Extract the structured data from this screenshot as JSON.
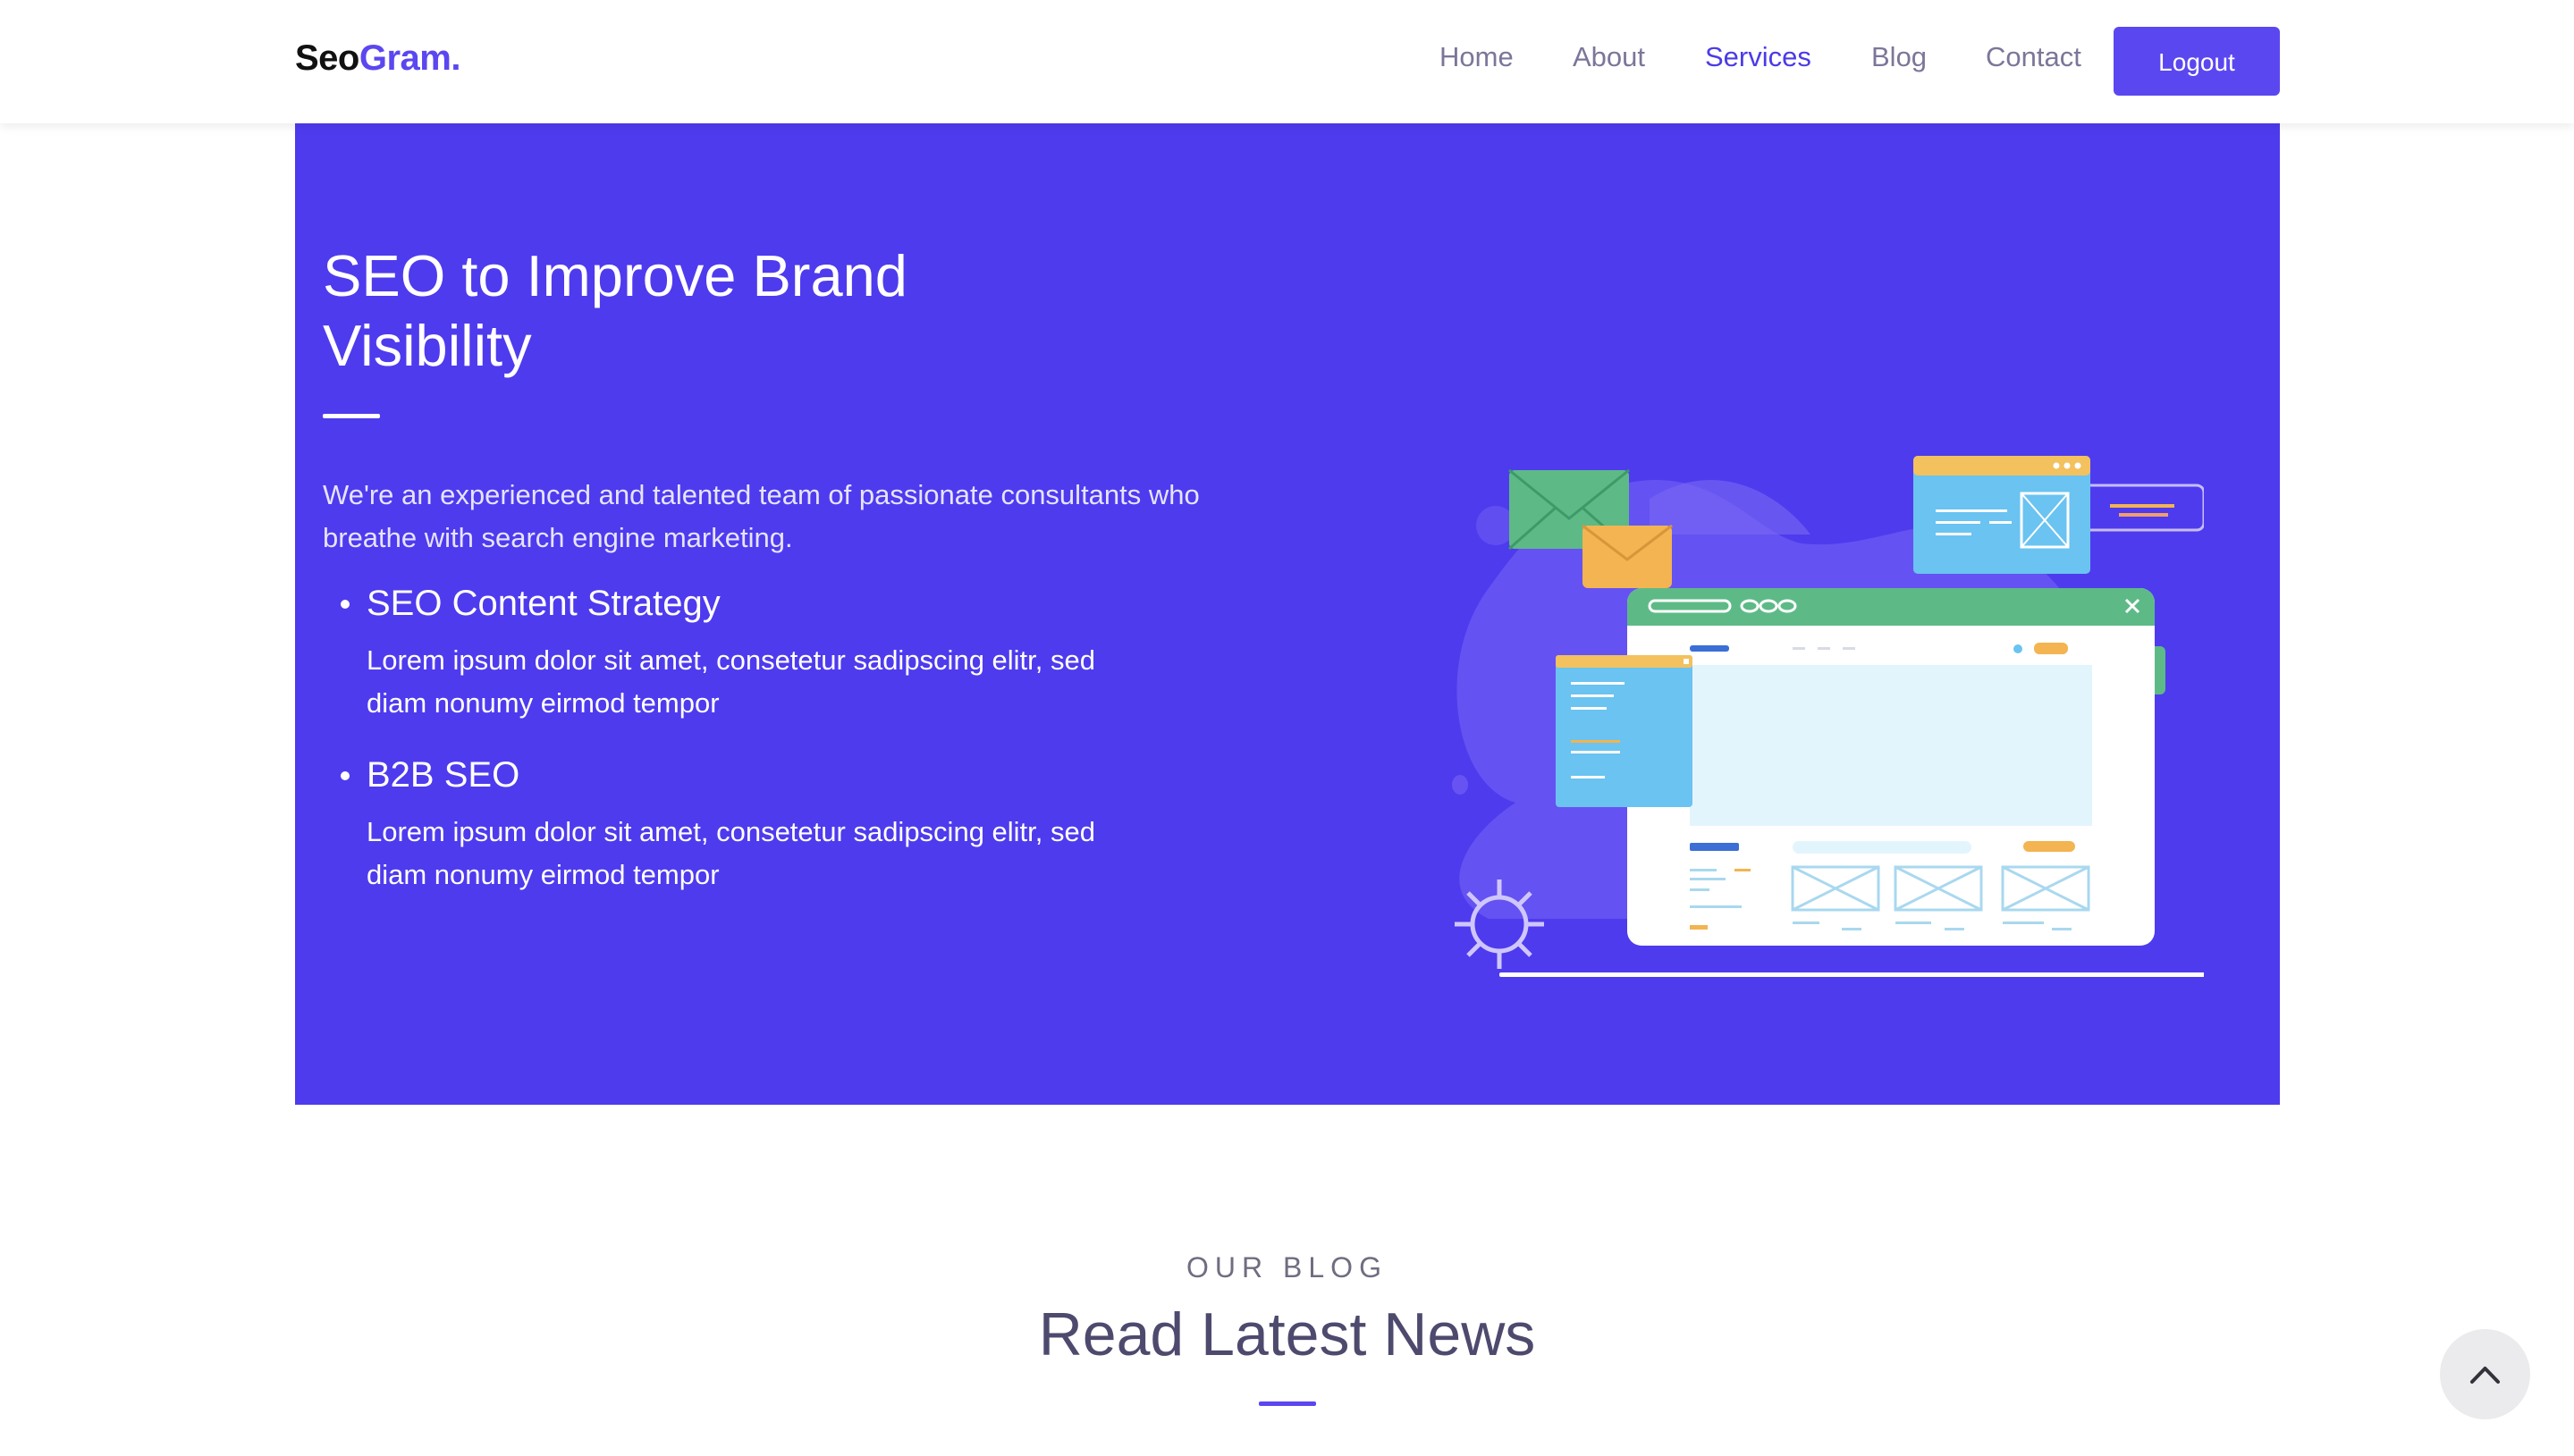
{
  "navbar": {
    "logo": {
      "part1": "Seo",
      "part2": "Gram."
    },
    "links": [
      {
        "label": "Home",
        "active": false
      },
      {
        "label": "About",
        "active": false
      },
      {
        "label": "Services",
        "active": true
      },
      {
        "label": "Blog",
        "active": false
      },
      {
        "label": "Contact",
        "active": false
      }
    ],
    "logout_label": "Logout"
  },
  "hero": {
    "title": "SEO to Improve Brand Visibility",
    "description": "We're an experienced and talented team of passionate consultants who breathe with search engine marketing.",
    "features": [
      {
        "title": "SEO Content Strategy",
        "description": "Lorem ipsum dolor sit amet, consetetur sadipscing elitr, sed diam nonumy eirmod tempor"
      },
      {
        "title": "B2B SEO",
        "description": "Lorem ipsum dolor sit amet, consetetur sadipscing elitr, sed diam nonumy eirmod tempor"
      }
    ],
    "illustration_icon": "seo-website-illustration"
  },
  "blog": {
    "eyebrow": "OUR BLOG",
    "title": "Read Latest News"
  },
  "scroll_top_icon": "chevron-up-icon",
  "colors": {
    "brand": "#5b47f0",
    "hero_bg": "#4e3bee",
    "nav_text": "#7b7699",
    "nav_active": "#4b3be6"
  }
}
